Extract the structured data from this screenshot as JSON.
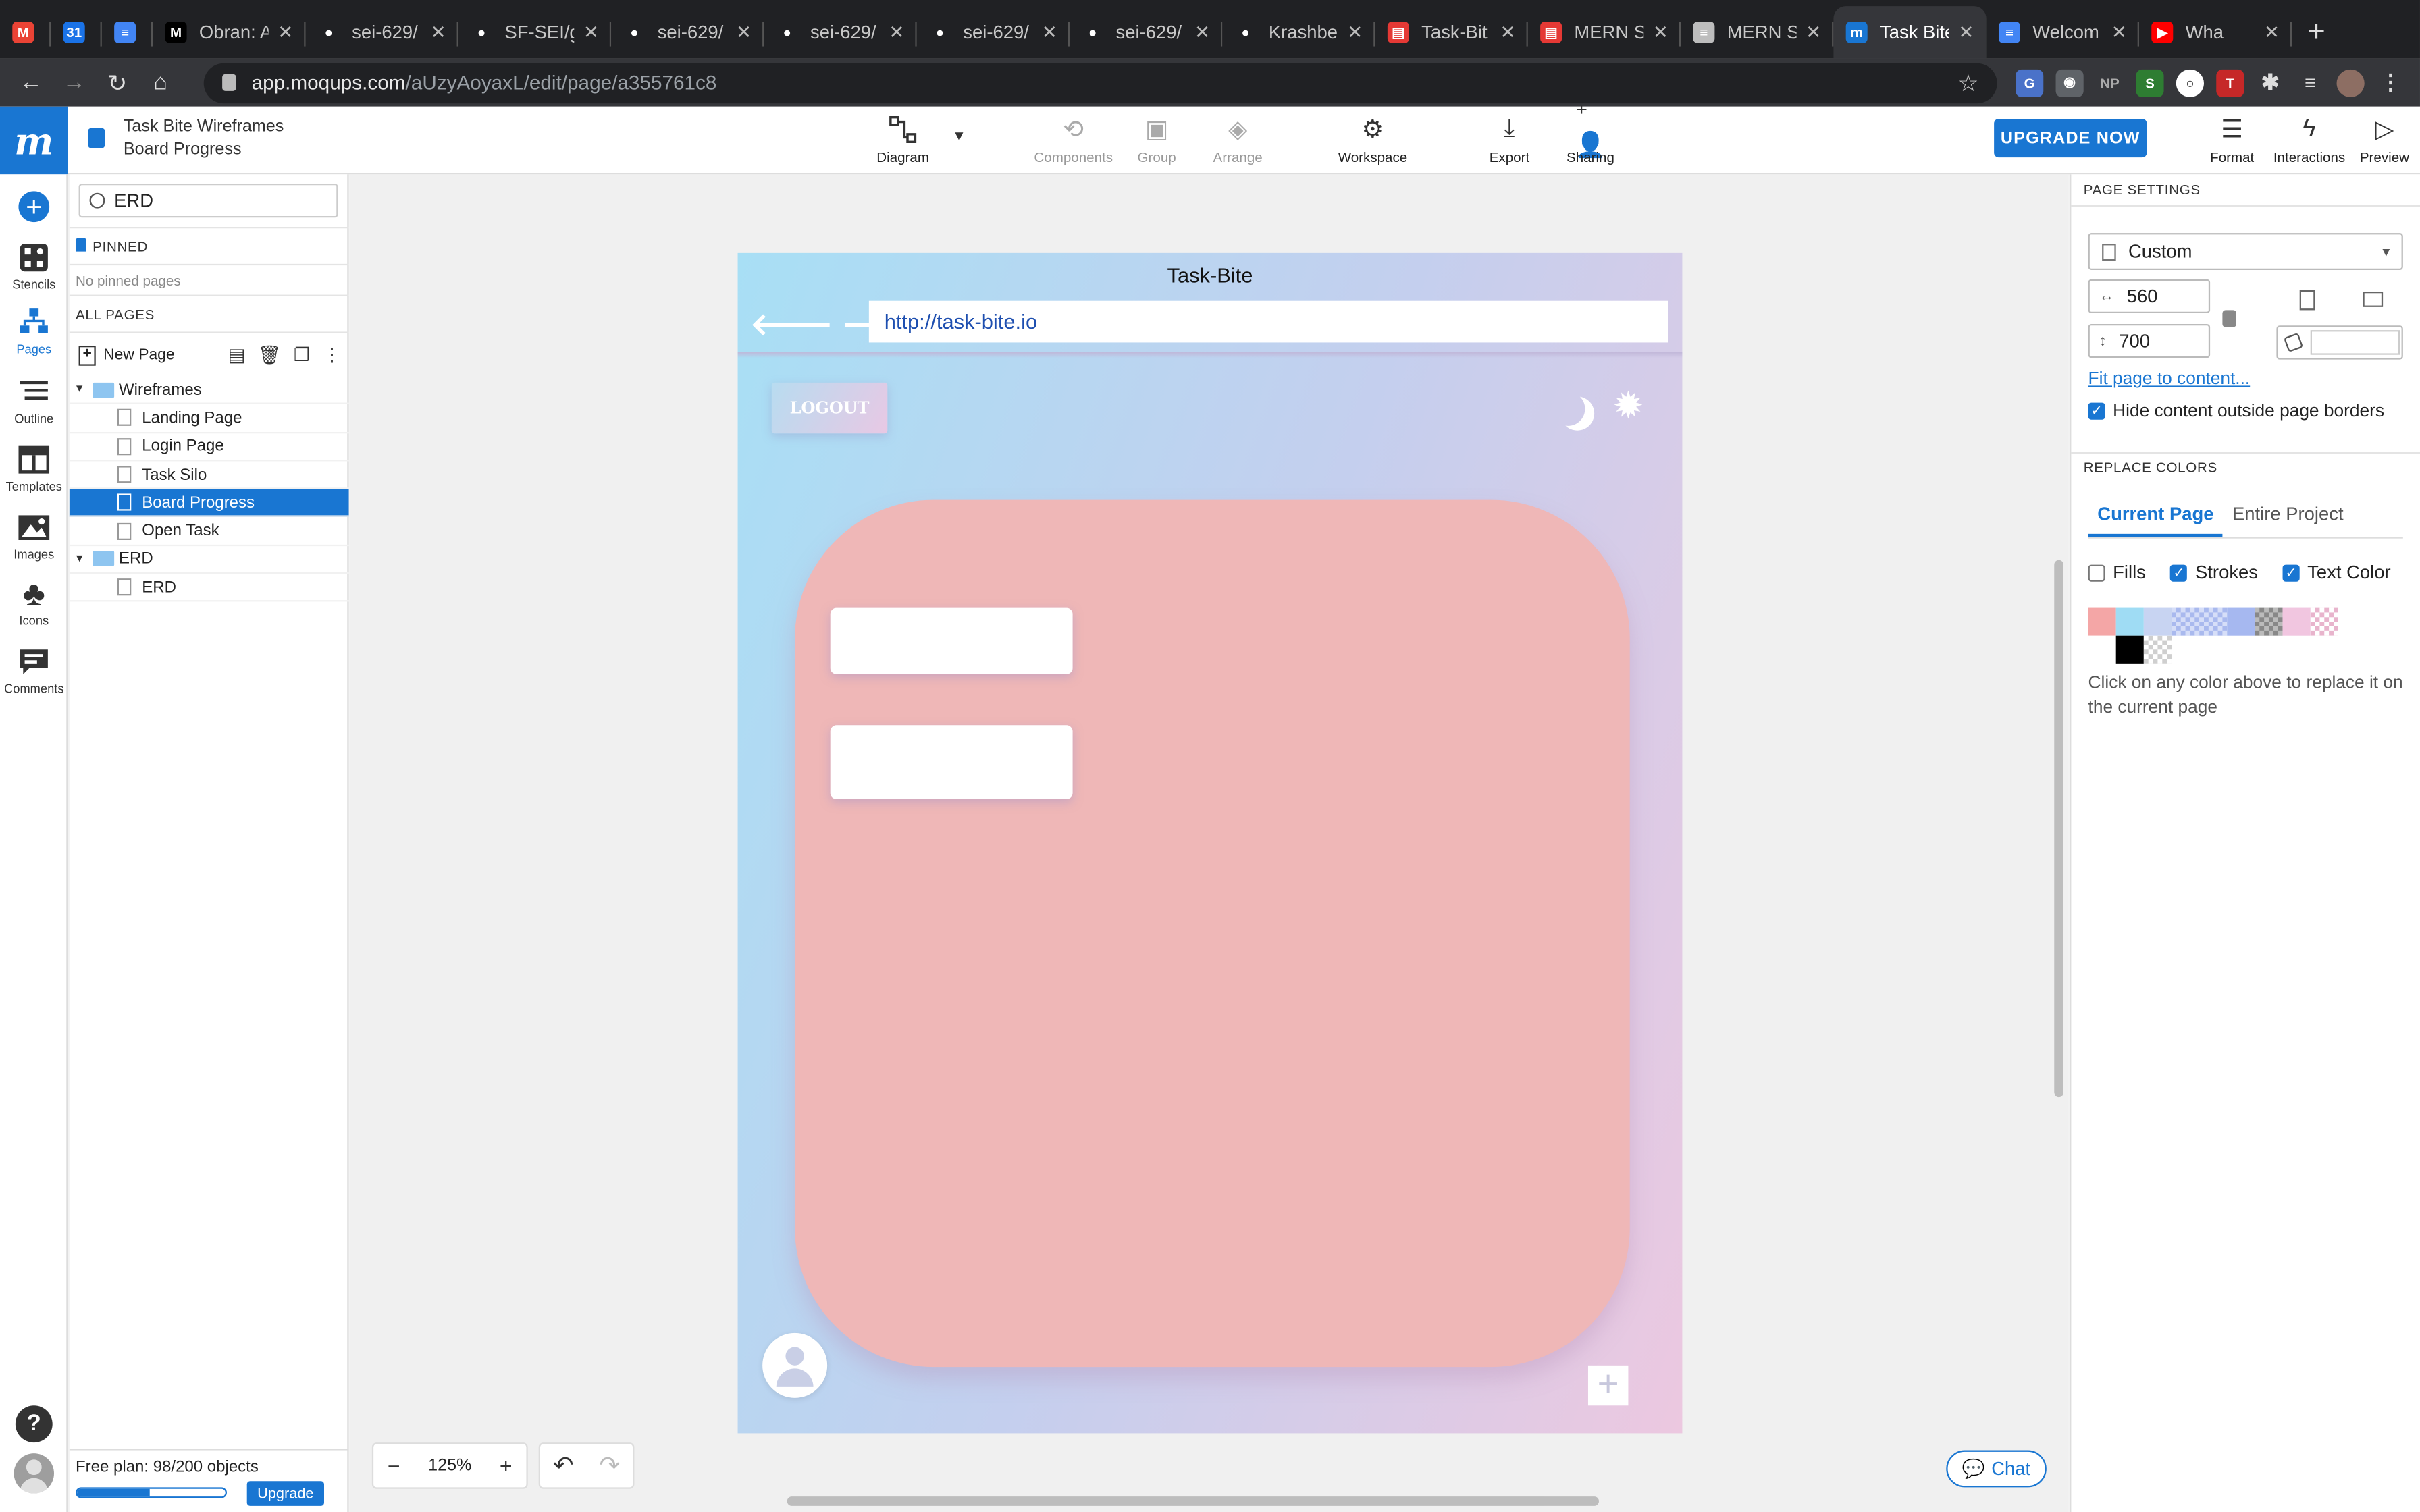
{
  "browser": {
    "tabs": [
      {
        "title": "",
        "favicon": "gmail",
        "color": "#ea4335"
      },
      {
        "title": "",
        "favicon": "calendar",
        "color": "#1a73e8"
      },
      {
        "title": "",
        "favicon": "docs",
        "color": "#4285f4"
      },
      {
        "title": "Obran: A",
        "favicon": "medium",
        "color": "#000000"
      },
      {
        "title": "sei-629/",
        "favicon": "github",
        "color": "#ffffff"
      },
      {
        "title": "SF-SEI/g",
        "favicon": "github",
        "color": "#ffffff"
      },
      {
        "title": "sei-629/",
        "favicon": "github",
        "color": "#ffffff"
      },
      {
        "title": "sei-629/",
        "favicon": "github",
        "color": "#ffffff"
      },
      {
        "title": "sei-629/",
        "favicon": "github",
        "color": "#ffffff"
      },
      {
        "title": "sei-629/",
        "favicon": "github",
        "color": "#ffffff"
      },
      {
        "title": "Krashbe",
        "favicon": "github",
        "color": "#ffffff"
      },
      {
        "title": "Task-Bit",
        "favicon": "trello",
        "color": "#ffffff"
      },
      {
        "title": "MERN St",
        "favicon": "trello",
        "color": "#ffffff"
      },
      {
        "title": "MERN St",
        "favicon": "doc",
        "color": "#bdbdbd"
      },
      {
        "title": "Task Bite",
        "favicon": "moqups",
        "color": "#1976d2",
        "active": true
      },
      {
        "title": "Welcom",
        "favicon": "docs",
        "color": "#4285f4"
      },
      {
        "title": "Wha",
        "favicon": "youtube",
        "color": "#ff0000"
      }
    ],
    "url_host": "app.moqups.com",
    "url_path": "/aUzyAoyaxL/edit/page/a355761c8"
  },
  "header": {
    "project_name": "Task Bite Wireframes",
    "page_name": "Board Progress",
    "tools": [
      {
        "label": "Diagram",
        "icon": "diagram-icon",
        "dim": false
      },
      {
        "label": "Components",
        "icon": "components-icon",
        "dim": true
      },
      {
        "label": "Group",
        "icon": "group-icon",
        "dim": true
      },
      {
        "label": "Arrange",
        "icon": "arrange-icon",
        "dim": true
      },
      {
        "label": "Workspace",
        "icon": "workspace-icon",
        "dim": false
      },
      {
        "label": "Export",
        "icon": "export-icon",
        "dim": false
      },
      {
        "label": "Sharing",
        "icon": "sharing-icon",
        "dim": false
      }
    ],
    "upgrade_label": "UPGRADE NOW",
    "right_tools": [
      {
        "label": "Format",
        "icon": "format-icon"
      },
      {
        "label": "Interactions",
        "icon": "lightning-icon"
      },
      {
        "label": "Preview",
        "icon": "preview-icon"
      }
    ]
  },
  "rail": {
    "items": [
      {
        "label": "Stencils",
        "icon": "stencils-icon"
      },
      {
        "label": "Pages",
        "icon": "pages-icon",
        "active": true
      },
      {
        "label": "Outline",
        "icon": "outline-icon"
      },
      {
        "label": "Templates",
        "icon": "templates-icon"
      },
      {
        "label": "Images",
        "icon": "images-icon"
      },
      {
        "label": "Icons",
        "icon": "club-icon"
      },
      {
        "label": "Comments",
        "icon": "comments-icon"
      }
    ]
  },
  "pages_panel": {
    "search_value": "ERD",
    "pinned_label": "PINNED",
    "no_pinned": "No pinned pages",
    "all_pages_label": "ALL PAGES",
    "new_page_label": "New Page",
    "tree": [
      {
        "type": "folder",
        "label": "Wireframes"
      },
      {
        "type": "page",
        "label": "Landing Page"
      },
      {
        "type": "page",
        "label": "Login Page"
      },
      {
        "type": "page",
        "label": "Task Silo"
      },
      {
        "type": "page",
        "label": "Board Progress",
        "selected": true
      },
      {
        "type": "page",
        "label": "Open Task"
      },
      {
        "type": "folder",
        "label": "ERD"
      },
      {
        "type": "page",
        "label": "ERD"
      }
    ],
    "free_plan": "Free plan: 98/200 objects",
    "plan_usage": 0.49,
    "upgrade_label": "Upgrade"
  },
  "canvas": {
    "zoom": "125%",
    "chat_label": "Chat",
    "wireframe": {
      "title": "Task-Bite",
      "url": "http://task-bite.io",
      "logout_label": "LOGOUT",
      "colors": {
        "card": "#efb7b7",
        "gradient_start": "#a8dff5",
        "gradient_end": "#ecc8e0"
      }
    }
  },
  "page_settings": {
    "title": "PAGE SETTINGS",
    "preset": "Custom",
    "width": "560",
    "height": "700",
    "fit_link": "Fit page to content...",
    "hide_content_label": "Hide content outside page borders",
    "hide_content_checked": true
  },
  "replace_colors": {
    "title": "REPLACE COLORS",
    "tabs": [
      "Current Page",
      "Entire Project"
    ],
    "active_tab": 0,
    "fills_label": "Fills",
    "fills_checked": false,
    "strokes_label": "Strokes",
    "strokes_checked": true,
    "text_color_label": "Text Color",
    "text_color_checked": true,
    "swatches": [
      "#f4a6a6",
      "#9fdcf4",
      "#c8d4f2",
      "checker-blue",
      "checker-blue2",
      "#a6b8f0",
      "checker-dark",
      "#f1c6e0",
      "checker-pink",
      "#ffffff",
      "#ffffff",
      "#000000",
      "checker-gray"
    ],
    "note": "Click on any color above to replace it on the current page"
  }
}
